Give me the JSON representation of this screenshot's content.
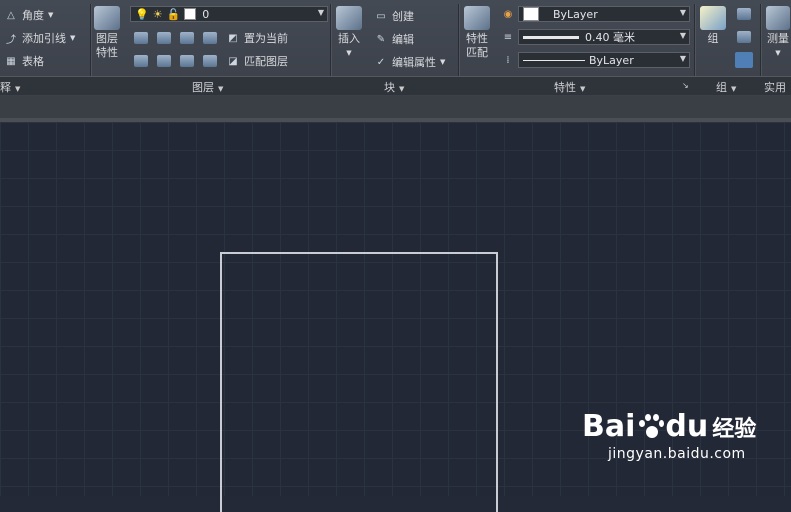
{
  "ribbon": {
    "annotation_panel": {
      "items": [
        {
          "label": "角度",
          "icon": "angle-icon"
        },
        {
          "label": "添加引线",
          "icon": "leader-icon"
        },
        {
          "label": "表格",
          "icon": "table-icon"
        }
      ],
      "title_partial": "释"
    },
    "layers_panel": {
      "title": "图层",
      "big_button_line1": "图层",
      "big_button_line2": "特性",
      "layer_combo_value": "0",
      "set_current_label": "置为当前",
      "match_layer_label": "匹配图层"
    },
    "block_panel": {
      "title": "块",
      "insert_label": "插入",
      "create_label": "创建",
      "edit_label": "编辑",
      "edit_attr_label": "编辑属性"
    },
    "properties_panel": {
      "title": "特性",
      "match_line1": "特性",
      "match_line2": "匹配",
      "color_value": "ByLayer",
      "lineweight_value": "0.40 毫米",
      "linetype_value": "ByLayer"
    },
    "groups_panel": {
      "title": "组",
      "group_label": "组"
    },
    "utilities_panel": {
      "title_partial": "实用",
      "measure_label": "测量"
    }
  },
  "watermark": {
    "brand_left": "Bai",
    "brand_right": "du",
    "brand_cn": "经验",
    "url": "jingyan.baidu.com"
  }
}
